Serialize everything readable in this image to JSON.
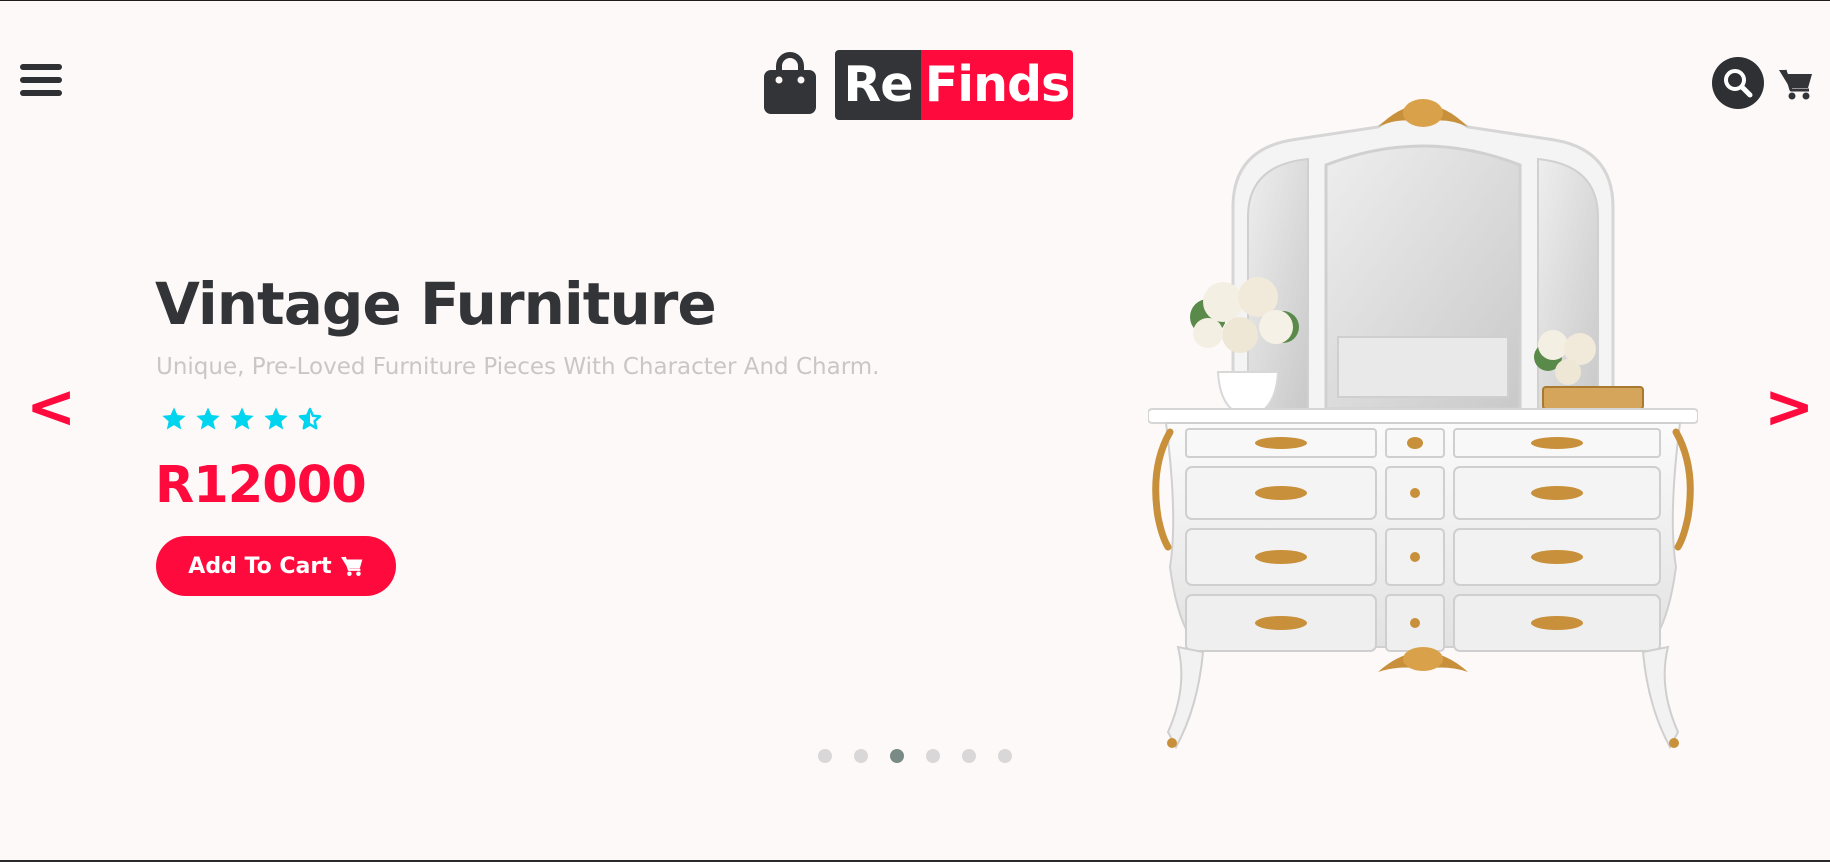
{
  "header": {
    "logo_re": "Re",
    "logo_finds": "Finds"
  },
  "hero": {
    "title": "Vintage Furniture",
    "subtitle": "Unique, Pre-Loved Furniture Pieces With Character And Charm.",
    "rating": 4.5,
    "rating_max": 5,
    "price": "R12000",
    "add_to_cart_label": "Add To Cart"
  },
  "slider": {
    "prev_label": "<",
    "next_label": ">",
    "dots_count": 6,
    "active_dot_index": 2
  },
  "icons": {
    "menu": "hamburger-menu-icon",
    "logo": "shopping-bag-icon",
    "search": "search-icon",
    "cart": "cart-icon",
    "star": "star-icon"
  },
  "colors": {
    "accent": "#ff0a3c",
    "dark": "#333437",
    "star": "#00d4ee",
    "background": "#fdf9f8",
    "dot_inactive": "#d9d7d7",
    "dot_active": "#7a8a86"
  }
}
